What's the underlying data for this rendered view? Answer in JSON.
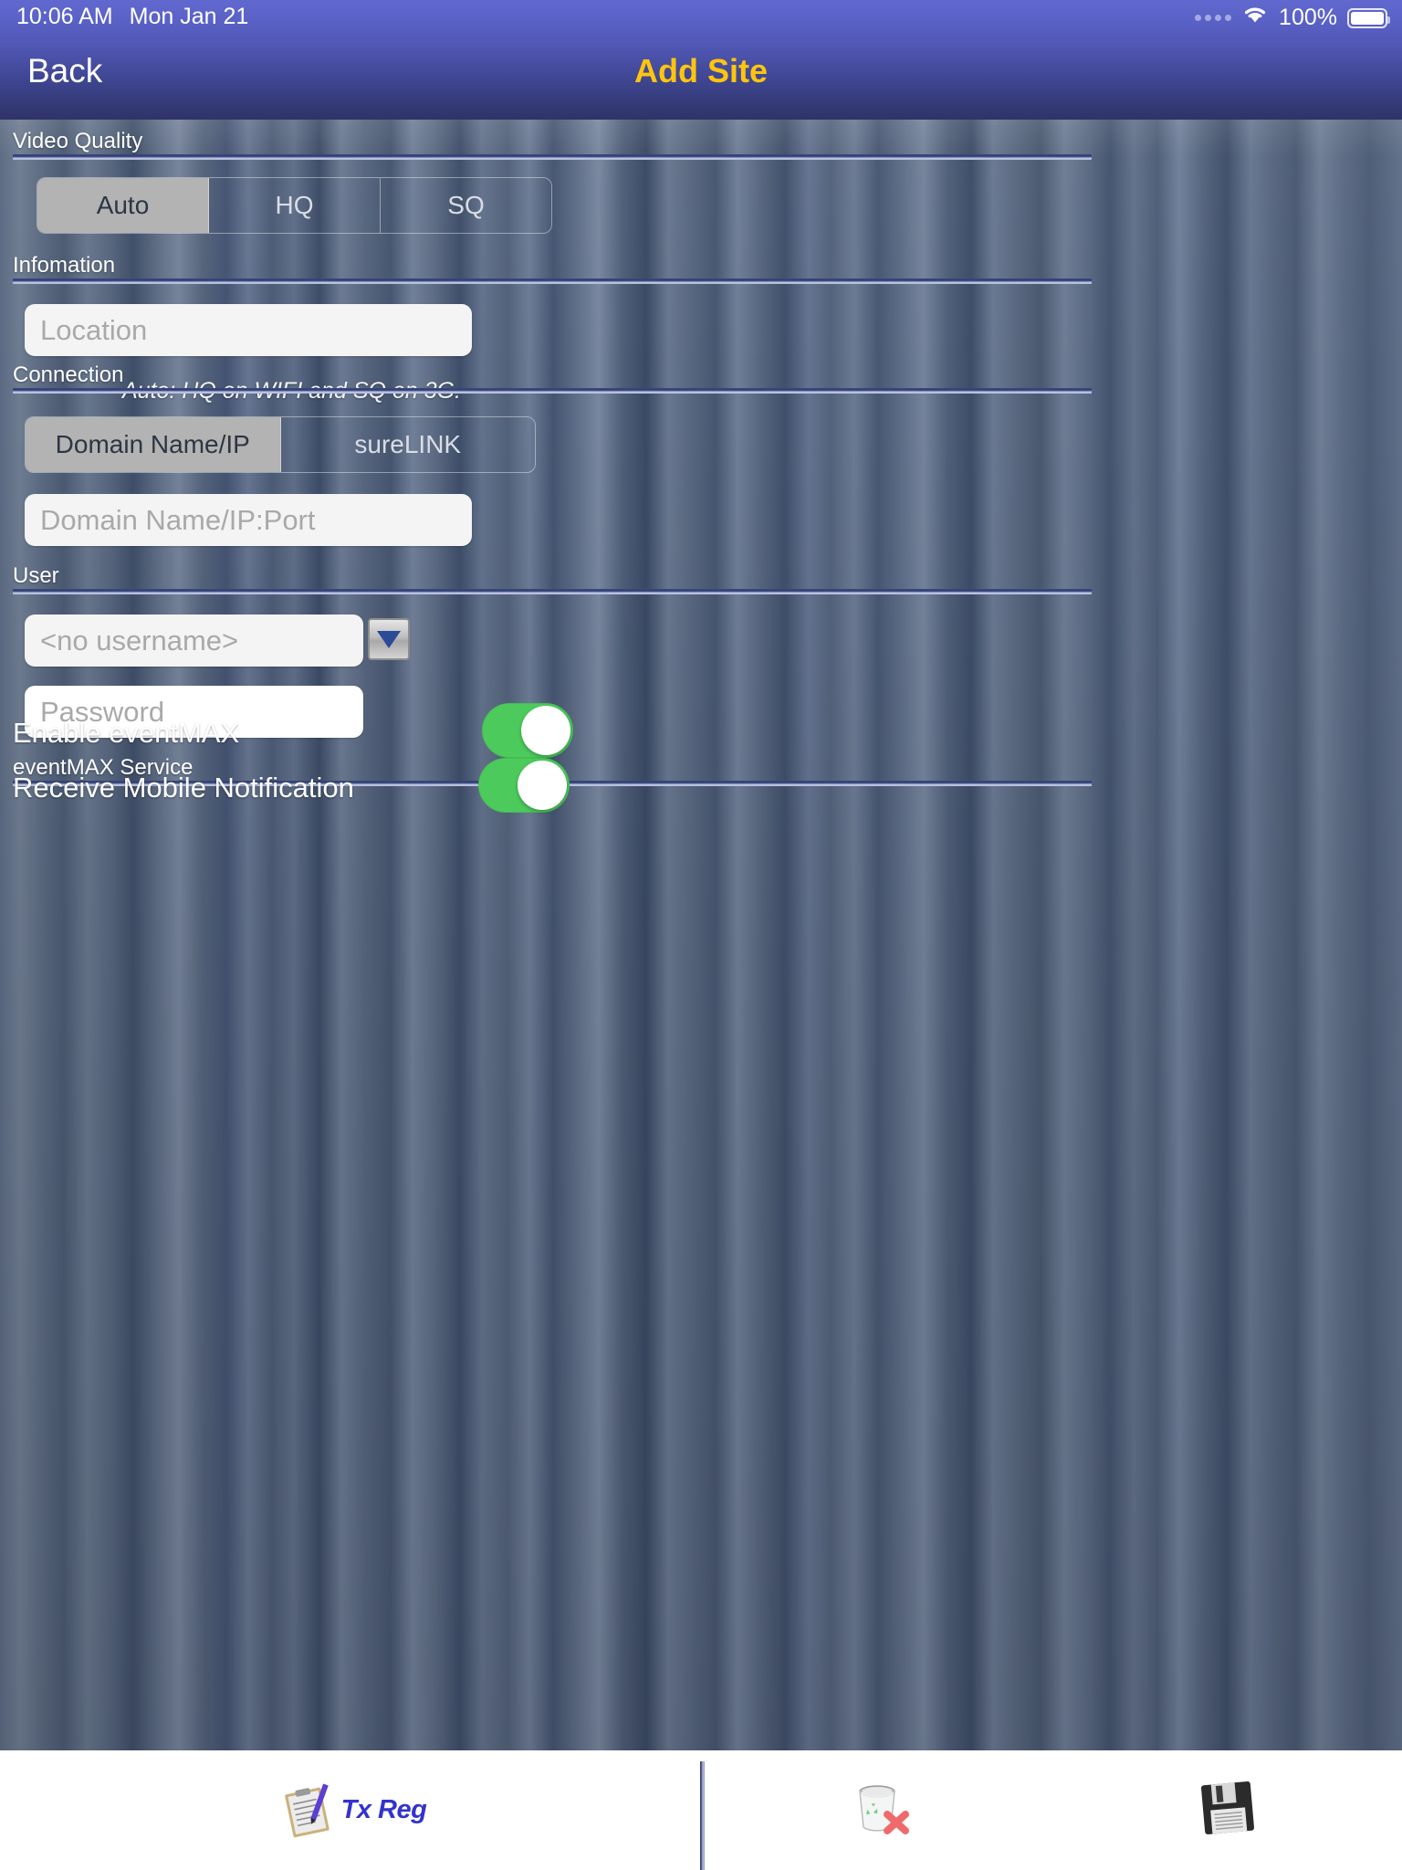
{
  "status_bar": {
    "time": "10:06 AM",
    "date": "Mon Jan 21",
    "battery_percent": "100%",
    "signal_icon": "signal-dots-icon",
    "wifi_icon": "wifi-icon",
    "battery_icon": "battery-full-icon"
  },
  "nav_bar": {
    "back_label": "Back",
    "title": "Add Site",
    "title_color": "#ffc50c"
  },
  "sections": {
    "video_quality": {
      "label": "Video Quality",
      "options": [
        "Auto",
        "HQ",
        "SQ"
      ],
      "selected": "Auto",
      "hint": "Auto: HQ on WIFI and SQ on 3G."
    },
    "information": {
      "label": "Infomation",
      "location_placeholder": "Location",
      "location_value": ""
    },
    "connection": {
      "label": "Connection",
      "options": [
        "Domain Name/IP",
        "sureLINK"
      ],
      "selected": "Domain Name/IP",
      "address_placeholder": "Domain Name/IP:Port",
      "address_value": ""
    },
    "user": {
      "label": "User",
      "username_placeholder": "<no username>",
      "username_value": "",
      "dropdown_icon": "chevron-down-icon",
      "password_placeholder": "Password",
      "password_value": ""
    },
    "eventmax": {
      "label": "eventMAX Service",
      "rows": [
        {
          "label": "Enable eventMAX",
          "state": "on"
        },
        {
          "label": "Receive Mobile Notification",
          "state": "on"
        }
      ],
      "toggle_on_color": "#4ccb5c"
    }
  },
  "toolbar": {
    "items": [
      {
        "label": "Tx Reg",
        "icon": "clipboard-pen-icon"
      },
      {
        "label": "",
        "icon": "trash-delete-icon"
      },
      {
        "label": "",
        "icon": "floppy-save-icon"
      }
    ]
  }
}
